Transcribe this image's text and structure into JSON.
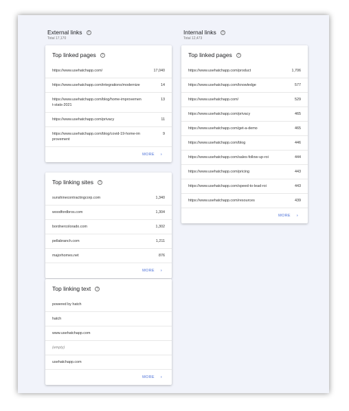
{
  "external": {
    "title": "External links",
    "total": "Total 17,170",
    "top_linked_pages": {
      "title": "Top linked pages",
      "rows": [
        {
          "url": "https://www.usehatchapp.com/",
          "count": "17,040"
        },
        {
          "url": "https://www.usehatchapp.com/integrations/modernize",
          "count": "14"
        },
        {
          "url": "https://www.usehatchapp.com/blog/home-improvement-stats-2021",
          "count": "13"
        },
        {
          "url": "https://www.usehatchapp.com/privacy",
          "count": "11"
        },
        {
          "url": "https://www.usehatchapp.com/blog/covid-19-home-improvement",
          "count": "9"
        }
      ],
      "more": "MORE"
    },
    "top_linking_sites": {
      "title": "Top linking sites",
      "rows": [
        {
          "site": "sunshinecontractingcorp.com",
          "count": "1,340"
        },
        {
          "site": "woodfordbros.com",
          "count": "1,304"
        },
        {
          "site": "bordnercolorado.com",
          "count": "1,302"
        },
        {
          "site": "pellabranch.com",
          "count": "1,211"
        },
        {
          "site": "majorhomes.net",
          "count": "876"
        }
      ],
      "more": "MORE"
    },
    "top_linking_text": {
      "title": "Top linking text",
      "rows": [
        "powered by hatch",
        "hatch",
        "www.usehatchapp.com",
        "(empty)",
        "usehatchapp.com"
      ],
      "more": "MORE"
    }
  },
  "internal": {
    "title": "Internal links",
    "total": "Total 12,473",
    "top_linked_pages": {
      "title": "Top linked pages",
      "rows": [
        {
          "url": "https://www.usehatchapp.com/product",
          "count": "1,706"
        },
        {
          "url": "https://www.usehatchapp.com/knowledge",
          "count": "577"
        },
        {
          "url": "https://www.usehatchapp.com/",
          "count": "529"
        },
        {
          "url": "https://www.usehatchapp.com/privacy",
          "count": "465"
        },
        {
          "url": "https://www.usehatchapp.com/get-a-demo",
          "count": "465"
        },
        {
          "url": "https://www.usehatchapp.com/blog",
          "count": "446"
        },
        {
          "url": "https://www.usehatchapp.com/sales-follow-up-roi",
          "count": "444"
        },
        {
          "url": "https://www.usehatchapp.com/pricing",
          "count": "443"
        },
        {
          "url": "https://www.usehatchapp.com/speed-to-lead-roi",
          "count": "443"
        },
        {
          "url": "https://www.usehatchapp.com/resources",
          "count": "439"
        }
      ],
      "more": "MORE"
    }
  },
  "colors": {
    "accent": "#4a6fd8",
    "background": "#f1f3fa"
  }
}
